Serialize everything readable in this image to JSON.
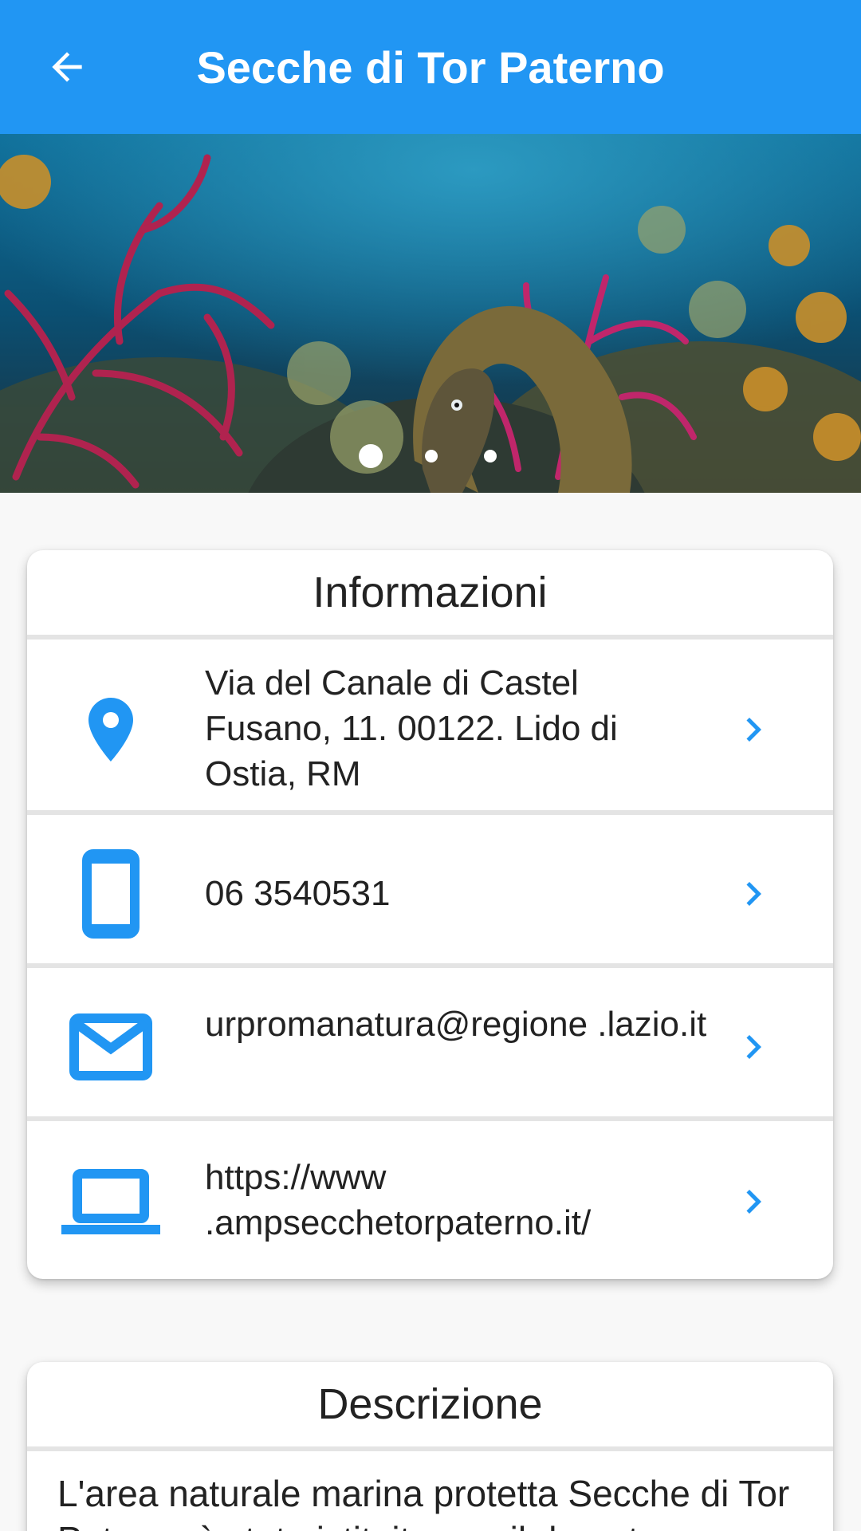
{
  "appbar": {
    "title": "Secche di Tor Paterno",
    "back_icon": "arrow-left-icon"
  },
  "carousel": {
    "image": "underwater-coral-moray-eel",
    "page_count": 3,
    "active_index": 0
  },
  "info_card": {
    "title": "Informazioni",
    "rows": [
      {
        "icon": "location-pin-icon",
        "text": "Via del Canale di Castel Fusano, 11. 00122. Lido di Ostia, RM"
      },
      {
        "icon": "smartphone-icon",
        "text": "06 3540531"
      },
      {
        "icon": "mail-icon",
        "text": "urpromanatura@regione .lazio.it"
      },
      {
        "icon": "laptop-icon",
        "text": "https://www .ampsecchetorpaterno.it/"
      }
    ]
  },
  "description_card": {
    "title": "Descrizione",
    "text": "L'area naturale marina protetta Secche di Tor Paterno è stata istituita con il decreto"
  },
  "colors": {
    "primary": "#2196f3",
    "background": "#f8f8f8",
    "card": "#ffffff",
    "divider": "#e4e4e4"
  }
}
